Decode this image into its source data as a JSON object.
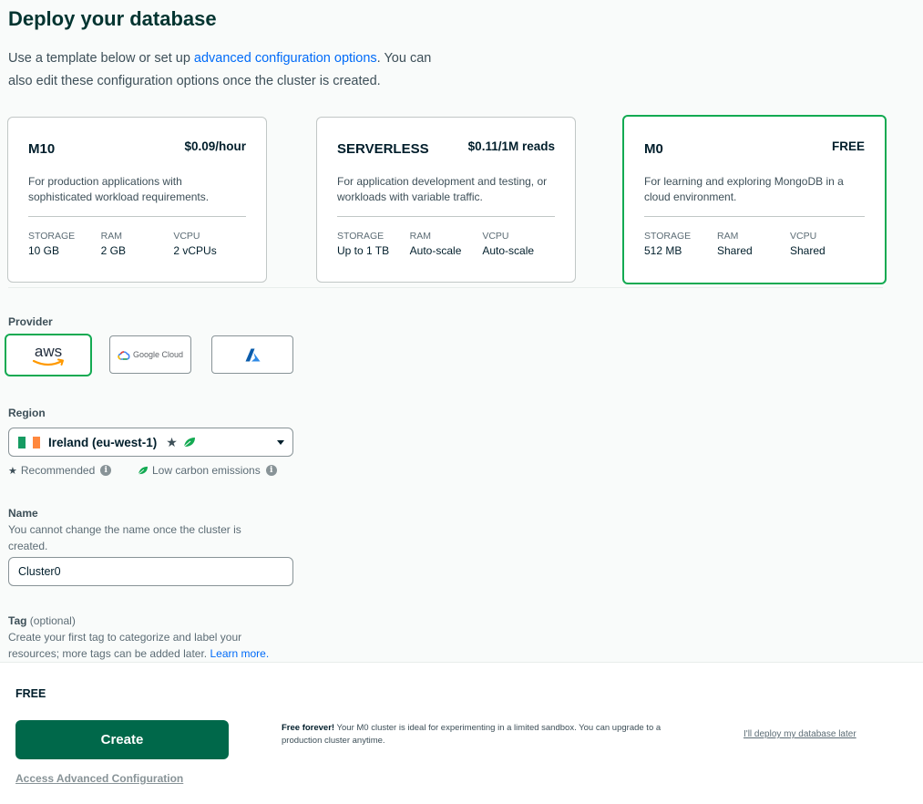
{
  "page": {
    "title": "Deploy your database",
    "intro_before": "Use a template below or set up ",
    "intro_link": "advanced configuration options",
    "intro_after": ". You can also edit these configuration options once the cluster is created."
  },
  "tiers": [
    {
      "name": "M10",
      "price": "$0.09/hour",
      "description": "For production applications with sophisticated workload requirements.",
      "specs": [
        {
          "label": "STORAGE",
          "value": "10 GB"
        },
        {
          "label": "RAM",
          "value": "2 GB"
        },
        {
          "label": "vCPU",
          "value": "2 vCPUs"
        }
      ]
    },
    {
      "name": "SERVERLESS",
      "price": "$0.11/1M reads",
      "description": "For application development and testing, or workloads with variable traffic.",
      "specs": [
        {
          "label": "STORAGE",
          "value": "Up to 1 TB"
        },
        {
          "label": "RAM",
          "value": "Auto-scale"
        },
        {
          "label": "vCPU",
          "value": "Auto-scale"
        }
      ]
    },
    {
      "name": "M0",
      "price": "FREE",
      "selected": true,
      "description": "For learning and exploring MongoDB in a cloud environment.",
      "specs": [
        {
          "label": "STORAGE",
          "value": "512 MB"
        },
        {
          "label": "RAM",
          "value": "Shared"
        },
        {
          "label": "vCPU",
          "value": "Shared"
        }
      ]
    }
  ],
  "provider": {
    "label": "Provider",
    "options": [
      {
        "name": "aws",
        "icon": "aws-logo",
        "selected": true
      },
      {
        "name": "Google Cloud",
        "icon": "google-cloud-logo"
      },
      {
        "name": "Azure",
        "icon": "azure-logo"
      }
    ]
  },
  "region": {
    "label": "Region",
    "selected": "Ireland (eu-west-1)",
    "flag_colors": [
      "#169b62",
      "#ffffff",
      "#ff883e"
    ],
    "legend_recommended": "Recommended",
    "legend_low_carbon": "Low carbon emissions",
    "star_icon": "star-icon",
    "leaf_icon": "leaf-icon",
    "leaf_color": "#13aa52"
  },
  "name_field": {
    "label": "Name",
    "helper": "You cannot change the name once the cluster is created.",
    "value": "Cluster0"
  },
  "tag_field": {
    "label": "Tag",
    "optional": " (optional)",
    "helper": "Create your first tag to categorize and label your resources; more tags can be added later.",
    "learn_more": "Learn more."
  },
  "footer": {
    "tier": "FREE",
    "create_label": "Create",
    "note_bold": "Free forever!",
    "note": " Your M0 cluster is ideal for experimenting in a limited sandbox. You can upgrade to a production cluster anytime.",
    "later_link": "I'll deploy my database later",
    "advanced_link": "Access Advanced Configuration"
  },
  "colors": {
    "accent_green": "#13aa52",
    "button_green": "#00684a",
    "link_blue": "#016bf8"
  }
}
